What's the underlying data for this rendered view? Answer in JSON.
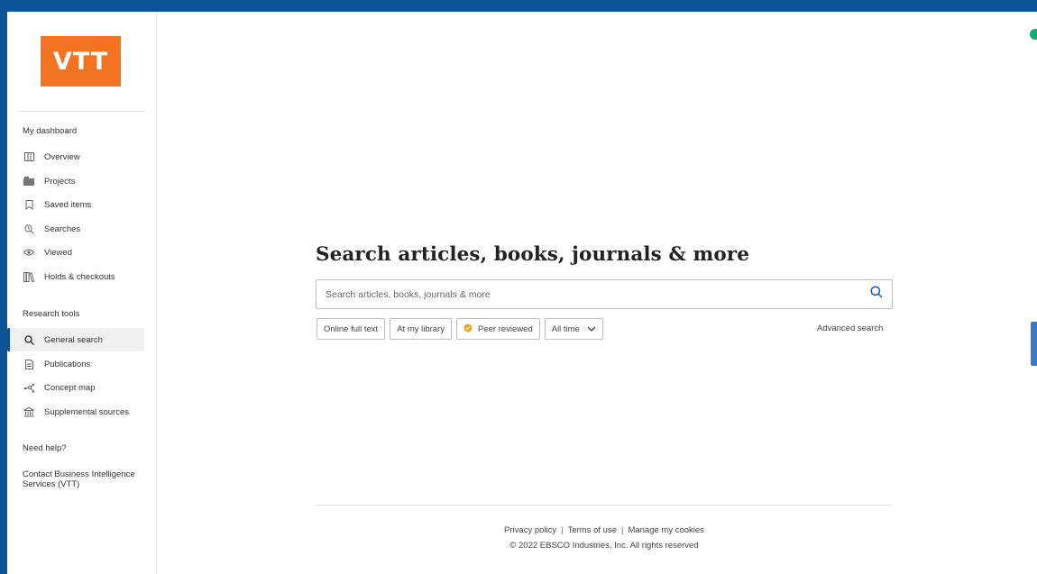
{
  "brand": {
    "logo_text": "VTT",
    "logo_color": "#f47320"
  },
  "colors": {
    "frame": "#0b5394",
    "accent_green": "#19a974",
    "side_tab": "#3a78c8"
  },
  "sidebar": {
    "dashboard_title": "My dashboard",
    "dashboard_items": [
      {
        "label": "Overview",
        "icon": "overview-icon"
      },
      {
        "label": "Projects",
        "icon": "projects-icon"
      },
      {
        "label": "Saved items",
        "icon": "bookmark-icon"
      },
      {
        "label": "Searches",
        "icon": "search-history-icon"
      },
      {
        "label": "Viewed",
        "icon": "eye-icon"
      },
      {
        "label": "Holds & checkouts",
        "icon": "books-icon"
      }
    ],
    "research_title": "Research tools",
    "research_items": [
      {
        "label": "General search",
        "icon": "search-icon",
        "active": true
      },
      {
        "label": "Publications",
        "icon": "document-icon"
      },
      {
        "label": "Concept map",
        "icon": "concept-map-icon"
      },
      {
        "label": "Supplemental sources",
        "icon": "institution-icon"
      }
    ],
    "help_title": "Need help?",
    "help_link": "Contact Business Intelligence Services (VTT)"
  },
  "main": {
    "headline": "Search articles, books, journals & more",
    "search_placeholder": "Search articles, books, journals & more",
    "filters": {
      "online_full_text": "Online full text",
      "at_my_library": "At my library",
      "peer_reviewed": "Peer reviewed",
      "date_range": "All time"
    },
    "advanced_search": "Advanced search"
  },
  "footer": {
    "privacy": "Privacy policy",
    "terms": "Terms of use",
    "cookies": "Manage my cookies",
    "copyright": "© 2022 EBSCO Industries, Inc. All rights reserved"
  }
}
